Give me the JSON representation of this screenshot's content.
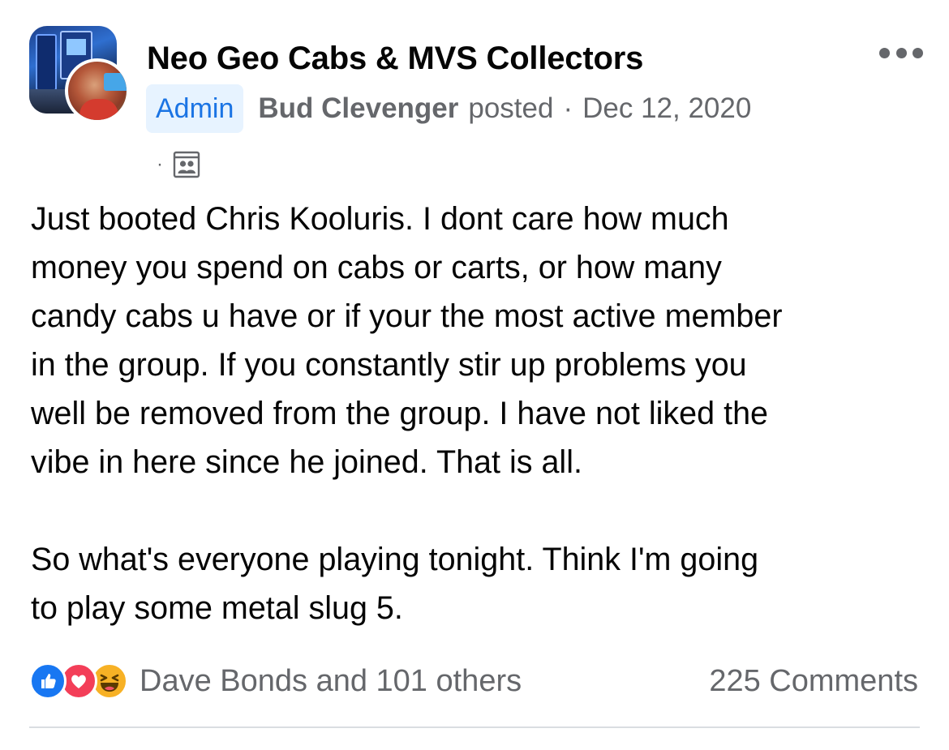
{
  "post": {
    "group_name": "Neo Geo Cabs & MVS Collectors",
    "role_badge": "Admin",
    "author": "Bud Clevenger",
    "action": "posted",
    "separator": "·",
    "date": "Dec 12, 2020",
    "privacy_dot": "·",
    "audience_icon": "group-audience-icon",
    "paragraphs": [
      "Just booted Chris Kooluris. I dont care how much\nmoney you spend on cabs or carts, or how many\ncandy cabs u have or if your the most active member\nin the group. If you constantly stir up problems you\nwell be removed from the group. I have not liked the\nvibe in here since he joined. That is all.",
      "So what's everyone playing tonight. Think I'm going\nto play some metal slug 5."
    ]
  },
  "reactions": {
    "icons": [
      "like-reaction-icon",
      "love-reaction-icon",
      "haha-reaction-icon"
    ],
    "summary": "Dave Bonds and 101 others",
    "comments": "225 Comments"
  },
  "colors": {
    "text_primary": "#050505",
    "text_secondary": "#65676b",
    "badge_bg": "#e7f3ff",
    "badge_text": "#1b74e4",
    "like_blue": "#1877f2",
    "love_red": "#f33e58",
    "haha_yellow": "#f7b125",
    "divider": "#dadde1"
  }
}
